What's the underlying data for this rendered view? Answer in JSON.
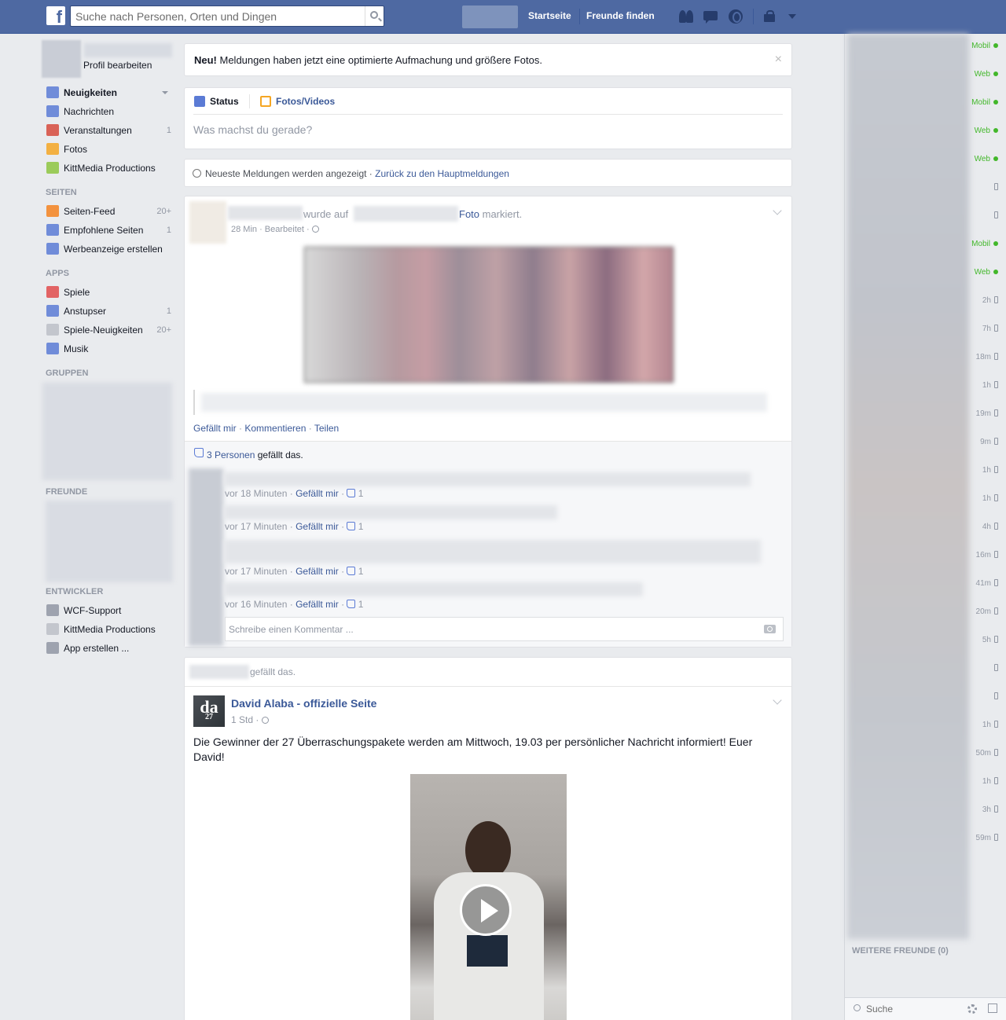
{
  "topbar": {
    "logo": "f",
    "search_placeholder": "Suche nach Personen, Orten und Dingen",
    "nav_home": "Startseite",
    "nav_find_friends": "Freunde finden"
  },
  "leftnav": {
    "edit_profile": "Profil bearbeiten",
    "main_items": [
      {
        "label": "Neuigkeiten",
        "count": "",
        "icon": "news-feed-icon",
        "color": "#5b7bd5"
      },
      {
        "label": "Nachrichten",
        "count": "",
        "icon": "messages-icon",
        "color": "#5b7bd5"
      },
      {
        "label": "Veranstaltungen",
        "count": "1",
        "icon": "events-icon",
        "color": "#d64a3c"
      },
      {
        "label": "Fotos",
        "count": "",
        "icon": "photos-icon",
        "color": "#f5a623"
      },
      {
        "label": "KittMedia Productions",
        "count": "",
        "icon": "kittmedia-icon",
        "color": "#8dc63f"
      }
    ],
    "pages_title": "SEITEN",
    "pages_items": [
      {
        "label": "Seiten-Feed",
        "count": "20+",
        "icon": "pages-feed-icon",
        "color": "#f5821f"
      },
      {
        "label": "Empfohlene Seiten",
        "count": "1",
        "icon": "like-pages-icon",
        "color": "#5b7bd5"
      },
      {
        "label": "Werbeanzeige erstellen",
        "count": "",
        "icon": "ads-chart-icon",
        "color": "#5b7bd5"
      }
    ],
    "apps_title": "APPS",
    "apps_items": [
      {
        "label": "Spiele",
        "count": "",
        "icon": "games-icon",
        "color": "#e14b4b"
      },
      {
        "label": "Anstupser",
        "count": "1",
        "icon": "poke-icon",
        "color": "#5b7bd5"
      },
      {
        "label": "Spiele-Neuigkeiten",
        "count": "20+",
        "icon": "gamepad-icon",
        "color": "#bcc0c7"
      },
      {
        "label": "Musik",
        "count": "",
        "icon": "music-icon",
        "color": "#5b7bd5"
      }
    ],
    "groups_title": "GRUPPEN",
    "friends_title": "FREUNDE",
    "dev_title": "ENTWICKLER",
    "dev_items": [
      {
        "label": "WCF-Support",
        "count": "",
        "icon": "wcf-icon",
        "color": "#9197a3"
      },
      {
        "label": "KittMedia Productions",
        "count": "",
        "icon": "kittmedia-dev-icon",
        "color": "#bcc0c7"
      },
      {
        "label": "App erstellen ...",
        "count": "",
        "icon": "create-app-icon",
        "color": "#9197a3"
      }
    ]
  },
  "notice": {
    "bold": "Neu!",
    "text": " Meldungen haben jetzt eine optimierte Aufmachung und größere Fotos.",
    "close": "×"
  },
  "composer": {
    "tab_status": "Status",
    "tab_photo": "Fotos/Videos",
    "placeholder": "Was machst du gerade?"
  },
  "sortbar": {
    "text": "Neueste Meldungen werden angezeigt · ",
    "link": "Zurück zu den Hauptmeldungen"
  },
  "post1": {
    "tagged_text": "wurde auf",
    "foto": "Foto",
    "markiert": " markiert.",
    "meta": "28 Min · Bearbeitet ·",
    "action_like": "Gefällt mir",
    "action_comment": "Kommentieren",
    "action_share": "Teilen",
    "likes_link": "3 Personen",
    "likes_text": " gefällt das.",
    "comments": [
      {
        "time": "vor 18 Minuten",
        "like": "Gefällt mir",
        "likes": "1"
      },
      {
        "time": "vor 17 Minuten",
        "like": "Gefällt mir",
        "likes": "1"
      },
      {
        "time": "vor 17 Minuten",
        "like": "Gefällt mir",
        "likes": "1"
      },
      {
        "time": "vor 16 Minuten",
        "like": "Gefällt mir",
        "likes": "1"
      }
    ],
    "comment_placeholder": "Schreibe einen Kommentar ..."
  },
  "post2": {
    "liked_text": "gefällt das.",
    "avatar_text": "da",
    "avatar_sub": "27",
    "page_name": "David Alaba - offizielle Seite",
    "time": "1 Std ·",
    "text": "Die Gewinner der 27 Überraschungspakete werden am Mittwoch, 19.03 per persönlicher Nachricht informiert! Euer David!"
  },
  "chat": {
    "statuses": [
      {
        "t": "Mobil",
        "online": true
      },
      {
        "t": "Web",
        "online": true
      },
      {
        "t": "Mobil",
        "online": true
      },
      {
        "t": "Web",
        "online": true
      },
      {
        "t": "Web",
        "online": true
      },
      {
        "t": "",
        "online": false
      },
      {
        "t": "",
        "online": false
      },
      {
        "t": "Mobil",
        "online": true
      },
      {
        "t": "Web",
        "online": true
      },
      {
        "t": "2h",
        "online": false
      },
      {
        "t": "7h",
        "online": false
      },
      {
        "t": "18m",
        "online": false
      },
      {
        "t": "1h",
        "online": false
      },
      {
        "t": "19m",
        "online": false
      },
      {
        "t": "9m",
        "online": false
      },
      {
        "t": "1h",
        "online": false
      },
      {
        "t": "1h",
        "online": false
      },
      {
        "t": "4h",
        "online": false
      },
      {
        "t": "16m",
        "online": false
      },
      {
        "t": "41m",
        "online": false
      },
      {
        "t": "20m",
        "online": false
      },
      {
        "t": "5h",
        "online": false
      },
      {
        "t": "",
        "online": false
      },
      {
        "t": "",
        "online": false
      },
      {
        "t": "1h",
        "online": false
      },
      {
        "t": "50m",
        "online": false
      },
      {
        "t": "1h",
        "online": false
      },
      {
        "t": "3h",
        "online": false
      },
      {
        "t": "59m",
        "online": false
      }
    ],
    "more_friends": "WEITERE FREUNDE (0)",
    "search_placeholder": "Suche"
  }
}
